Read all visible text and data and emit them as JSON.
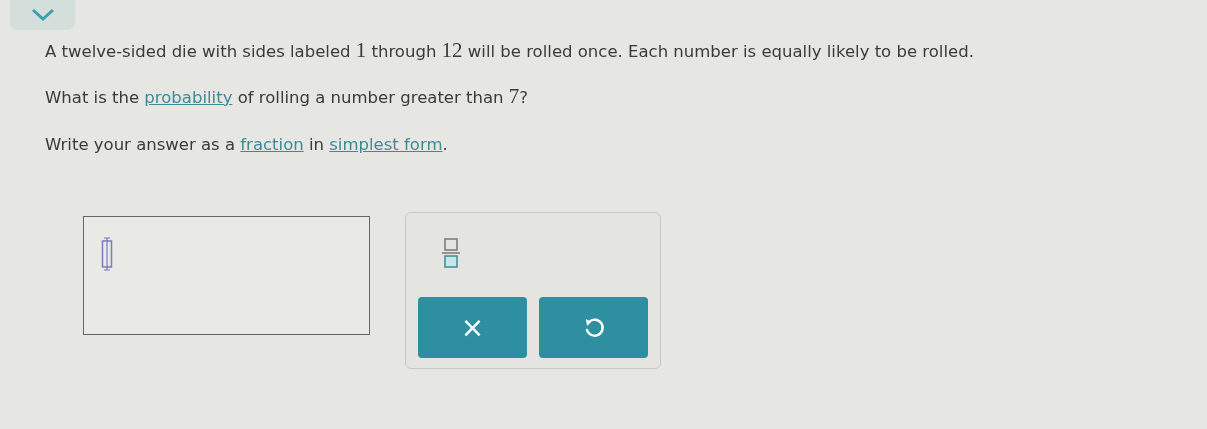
{
  "paragraphs": [
    {
      "parts": [
        {
          "kind": "text",
          "text": "A twelve-sided die with sides labeled "
        },
        {
          "kind": "number",
          "text": "1"
        },
        {
          "kind": "text",
          "text": " through "
        },
        {
          "kind": "number",
          "text": "12"
        },
        {
          "kind": "text",
          "text": " will be rolled once. Each number is equally likely to be rolled."
        }
      ]
    },
    {
      "parts": [
        {
          "kind": "text",
          "text": "What is the "
        },
        {
          "kind": "link",
          "text": "probability"
        },
        {
          "kind": "text",
          "text": " of rolling a number greater than "
        },
        {
          "kind": "number",
          "text": "7"
        },
        {
          "kind": "text",
          "text": "?"
        }
      ]
    },
    {
      "parts": [
        {
          "kind": "text",
          "text": "Write your answer as a "
        },
        {
          "kind": "link",
          "text": "fraction"
        },
        {
          "kind": "text",
          "text": " in "
        },
        {
          "kind": "link",
          "text": "simplest form"
        },
        {
          "kind": "text",
          "text": "."
        }
      ]
    }
  ],
  "palette": {
    "buttons": [
      {
        "kind": "clear",
        "label": "×"
      },
      {
        "kind": "undo"
      }
    ]
  }
}
